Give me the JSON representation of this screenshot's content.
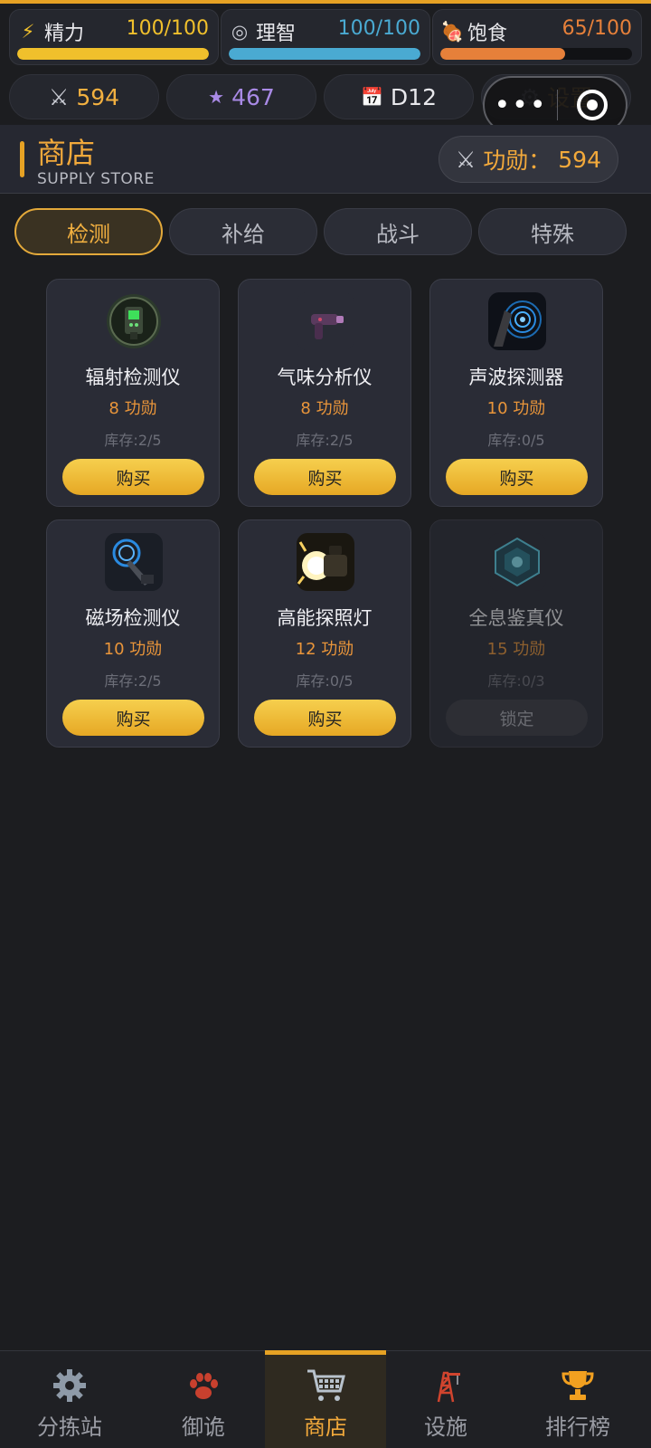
{
  "stats": [
    {
      "label": "精力",
      "icon": "⚡",
      "icon_name": "lightning-icon",
      "value": "100/100",
      "fraction": 1.0,
      "color": "#f0c02c",
      "value_color": "#f0c02c"
    },
    {
      "label": "理智",
      "icon": "◎",
      "icon_name": "target-icon",
      "value": "100/100",
      "fraction": 1.0,
      "color": "#4aaad2",
      "value_color": "#4aaad2"
    },
    {
      "label": "饱食",
      "icon": "🍖",
      "icon_name": "meat-icon",
      "value": "65/100",
      "fraction": 0.65,
      "color": "#e6803a",
      "value_color": "#e6803a"
    }
  ],
  "pills": {
    "merit": {
      "icon": "⚔",
      "value": "594",
      "color": "#f2b040"
    },
    "stars": {
      "icon": "★",
      "value": "467",
      "color": "#a98ae6"
    },
    "day": {
      "icon": "📅",
      "value": "D12",
      "color": "#ffffff"
    },
    "settings": {
      "icon": "⚙",
      "label": "设置",
      "color": "#e3a93a"
    }
  },
  "capsule": {
    "dots": "•••"
  },
  "header": {
    "title": "商店",
    "subtitle": "SUPPLY STORE",
    "merit_icon": "⚔",
    "merit_label": "功勋：",
    "merit_value": "594"
  },
  "tabs": [
    {
      "label": "检测",
      "active": true
    },
    {
      "label": "补给",
      "active": false
    },
    {
      "label": "战斗",
      "active": false
    },
    {
      "label": "特殊",
      "active": false
    }
  ],
  "items": [
    {
      "name": "辐射检测仪",
      "price": "8 功勋",
      "stock": "库存:2/5",
      "button": "购买",
      "locked": false,
      "icon_name": "radiation-detector-icon"
    },
    {
      "name": "气味分析仪",
      "price": "8 功勋",
      "stock": "库存:2/5",
      "button": "购买",
      "locked": false,
      "icon_name": "odor-analyzer-icon"
    },
    {
      "name": "声波探测器",
      "price": "10 功勋",
      "stock": "库存:0/5",
      "button": "购买",
      "locked": false,
      "icon_name": "sonar-detector-icon"
    },
    {
      "name": "磁场检测仪",
      "price": "10 功勋",
      "stock": "库存:2/5",
      "button": "购买",
      "locked": false,
      "icon_name": "magnetic-detector-icon"
    },
    {
      "name": "高能探照灯",
      "price": "12 功勋",
      "stock": "库存:0/5",
      "button": "购买",
      "locked": false,
      "icon_name": "searchlight-icon"
    },
    {
      "name": "全息鉴真仪",
      "price": "15 功勋",
      "stock": "库存:0/3",
      "button": "锁定",
      "locked": true,
      "icon_name": "hologram-verifier-icon"
    }
  ],
  "nav": [
    {
      "label": "分拣站",
      "icon_name": "gear-icon",
      "active": false
    },
    {
      "label": "御诡",
      "icon_name": "paw-icon",
      "active": false
    },
    {
      "label": "商店",
      "icon_name": "cart-icon",
      "active": true
    },
    {
      "label": "设施",
      "icon_name": "tower-icon",
      "active": false
    },
    {
      "label": "排行榜",
      "icon_name": "trophy-icon",
      "active": false
    }
  ]
}
